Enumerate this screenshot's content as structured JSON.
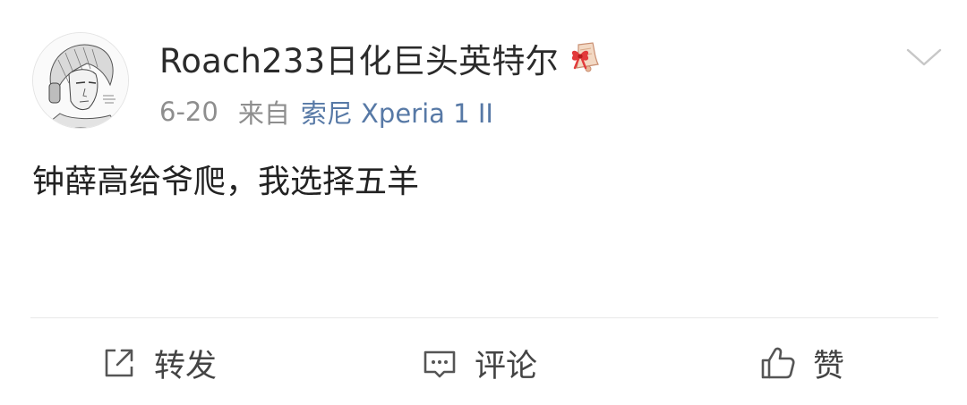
{
  "post": {
    "author": {
      "name": "Roach233日化巨头英特尔",
      "avatar": "sketch-portrait-avatar",
      "badge": "bell-ribbon-badge"
    },
    "meta": {
      "date": "6-20",
      "source_prefix": "来自",
      "source_device": "索尼 Xperia 1 II"
    },
    "text": "钟薛高给爷爬，我选择五羊",
    "more_icon": "chevron-down-icon"
  },
  "actions": {
    "repost": {
      "label": "转发",
      "icon": "share-out-icon"
    },
    "comment": {
      "label": "评论",
      "icon": "comment-bubble-icon"
    },
    "like": {
      "label": "赞",
      "icon": "thumbs-up-icon"
    }
  },
  "colors": {
    "link": "#5779a6",
    "muted": "#8e8e8e",
    "text": "#222222",
    "divider": "#e8e8e8"
  }
}
